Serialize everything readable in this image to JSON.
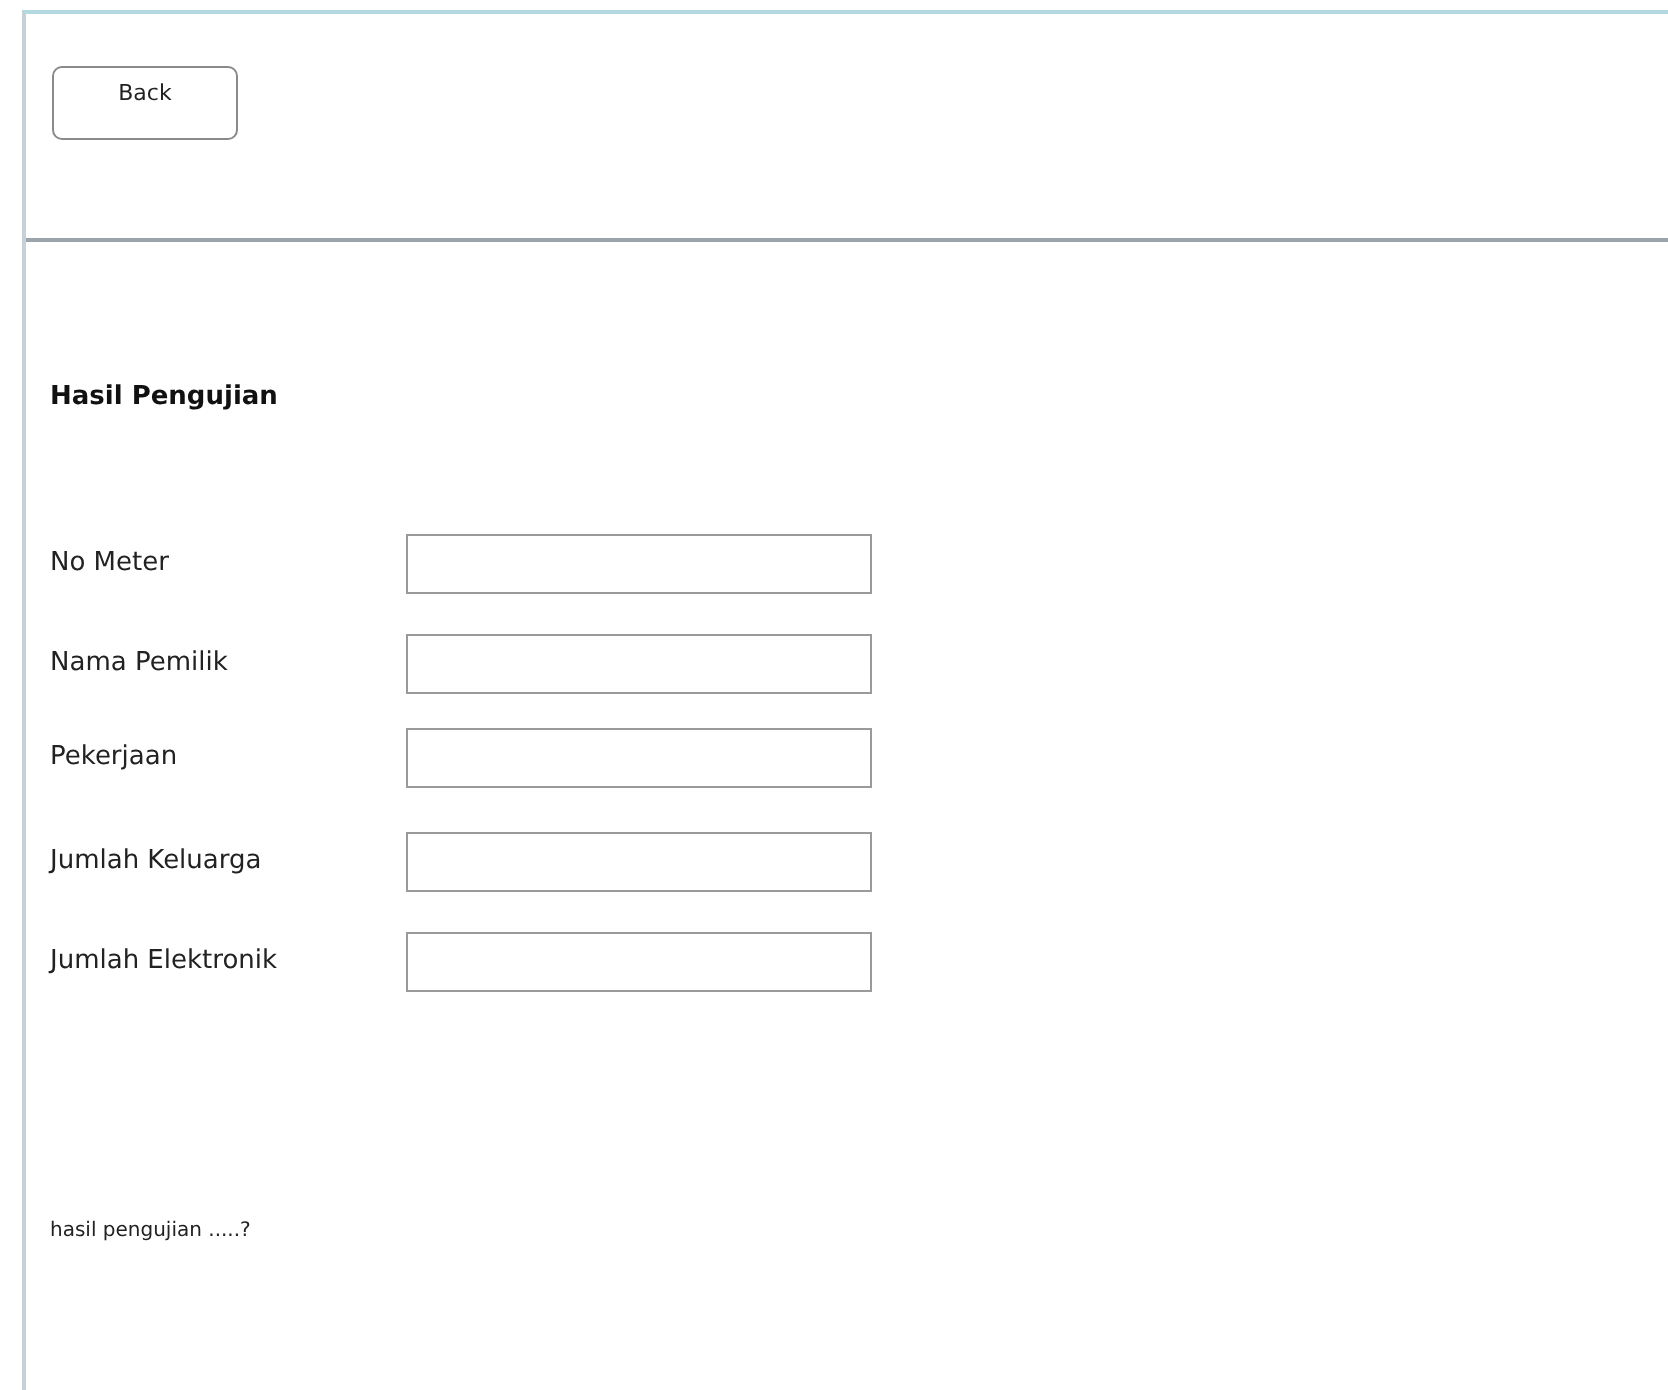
{
  "back_button": {
    "label": "Back"
  },
  "form": {
    "title": "Hasil Pengujian",
    "fields": [
      {
        "label": "No Meter"
      },
      {
        "label": "Nama Pemilik"
      },
      {
        "label": "Pekerjaan"
      },
      {
        "label": "Jumlah Keluarga"
      },
      {
        "label": "Jumlah Elektronik"
      }
    ]
  },
  "result_text": "hasil pengujian .....?"
}
